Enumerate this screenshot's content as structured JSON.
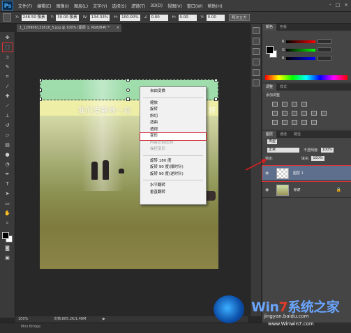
{
  "app": {
    "logo": "Ps",
    "menus": [
      "文件(F)",
      "编辑(E)",
      "图像(I)",
      "图层(L)",
      "文字(Y)",
      "选择(S)",
      "滤镜(T)",
      "3D(D)",
      "视图(V)",
      "窗口(W)",
      "帮助(H)"
    ],
    "window_controls": [
      "-",
      "□",
      "×"
    ]
  },
  "options": {
    "x_label": "X:",
    "x_value": "246.50 像素",
    "y_label": "Y:",
    "y_value": "30.00 像素",
    "w_label": "W:",
    "w_value": "134.33%",
    "h_label": "H:",
    "h_value": "100.00%",
    "angle_value": "0.00",
    "hskew_label": "H:",
    "hskew_value": "0.00",
    "vskew_label": "V:",
    "vskew_value": "0.00",
    "interpolation": "两次立方"
  },
  "document": {
    "tab_title": "1_120906131610_5.jpg @ 100% (图层 1, RGB/8#) *",
    "tab_close": "×",
    "caption": "我们安静地一起",
    "caption_end": "好"
  },
  "context_menu": {
    "items": [
      {
        "label": "自由变换",
        "enabled": true
      },
      {
        "sep": true
      },
      {
        "label": "缩放",
        "enabled": true
      },
      {
        "label": "旋转",
        "enabled": true
      },
      {
        "label": "斜切",
        "enabled": true
      },
      {
        "label": "扭曲",
        "enabled": true
      },
      {
        "label": "透视",
        "enabled": true
      },
      {
        "label": "变形",
        "enabled": true,
        "highlight": true
      },
      {
        "label": "内容识别比例",
        "enabled": false
      },
      {
        "label": "操控变形",
        "enabled": false
      },
      {
        "sep": true
      },
      {
        "label": "旋转 180 度",
        "enabled": true
      },
      {
        "label": "旋转 90 度(顺时针)",
        "enabled": true
      },
      {
        "label": "旋转 90 度(逆时针)",
        "enabled": true
      },
      {
        "sep": true
      },
      {
        "label": "水平翻转",
        "enabled": true
      },
      {
        "label": "垂直翻转",
        "enabled": true
      }
    ]
  },
  "status": {
    "zoom": "100%",
    "doc_size": "文档:805.2K/1.48M",
    "arrow": "▶",
    "bottom_label": "Mini Bridge"
  },
  "panels": {
    "color_tabs": [
      "颜色",
      "色板"
    ],
    "slider_letters": [
      "R",
      "G",
      "B"
    ],
    "adjust_tabs": [
      "调整",
      "样式"
    ],
    "adjust_label": "添加调整",
    "layers_tabs": [
      "图层",
      "通道",
      "路径"
    ],
    "kind_label": "类型",
    "blend_mode": "正常",
    "opacity_label": "不透明度:",
    "opacity_value": "100%",
    "lock_label": "锁定:",
    "fill_label": "填充:",
    "fill_value": "100%",
    "layers": [
      {
        "name": "图层 1",
        "selected": true,
        "thumb": "checker",
        "lock": ""
      },
      {
        "name": "背景",
        "selected": false,
        "thumb": "photo",
        "lock": "🔒"
      }
    ]
  },
  "watermark": {
    "title_a": "Win",
    "title_b": "7",
    "title_c": "系统之家",
    "url1": "jingyan.baidu.com",
    "url2": "www.Winwin7.com"
  },
  "colors": {
    "menu_highlight_outline": "#cc2233",
    "selected_layer": "#5d6f8c",
    "annotation_arrow": "#d42020"
  }
}
